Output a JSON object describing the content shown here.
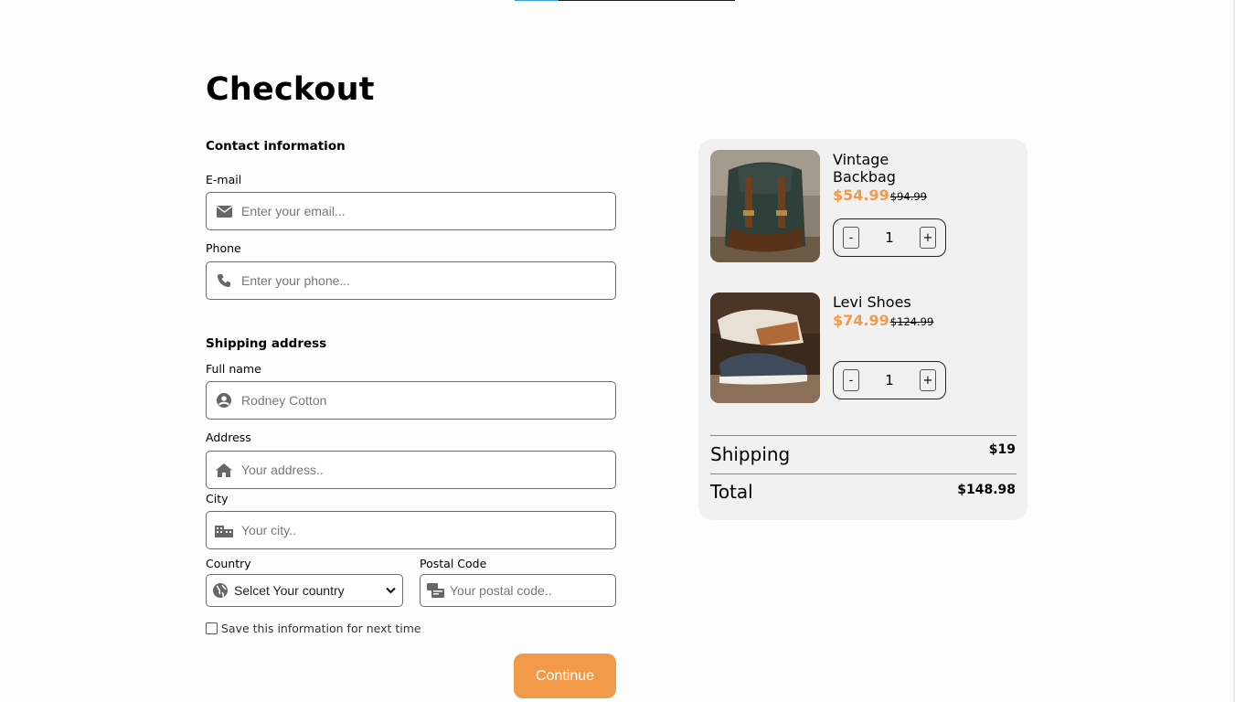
{
  "page": {
    "title": "Checkout",
    "accent_color": "#f3994a"
  },
  "contact": {
    "heading": "Contact information",
    "email": {
      "label": "E-mail",
      "placeholder": "Enter your email...",
      "icon": "envelope-icon"
    },
    "phone": {
      "label": "Phone",
      "placeholder": "Enter your phone...",
      "icon": "phone-icon"
    }
  },
  "shipping": {
    "heading": "Shipping address",
    "full_name": {
      "label": "Full name",
      "placeholder": "Rodney Cotton",
      "icon": "user-circle-icon"
    },
    "address": {
      "label": "Address",
      "placeholder": "Your address..",
      "icon": "home-icon"
    },
    "city": {
      "label": "City",
      "placeholder": "Your city..",
      "icon": "city-icon"
    },
    "country": {
      "label": "Country",
      "selected": "Selcet Your country",
      "icon": "globe-icon"
    },
    "postal": {
      "label": "Postal Code",
      "placeholder": "Your postal code..",
      "icon": "mail-bulk-icon"
    },
    "save_label": "Save this information for next time",
    "continue_label": "Continue"
  },
  "cart": {
    "items": [
      {
        "name": "Vintage Backbag",
        "price": "$54.99",
        "old_price": "$94.99",
        "quantity": "1",
        "minus": "-",
        "plus": "+"
      },
      {
        "name": "Levi Shoes",
        "price": "$74.99",
        "old_price": "$124.99",
        "quantity": "1",
        "minus": "-",
        "plus": "+"
      }
    ],
    "shipping_label": "Shipping",
    "shipping_value": "$19",
    "total_label": "Total",
    "total_value": "$148.98"
  }
}
